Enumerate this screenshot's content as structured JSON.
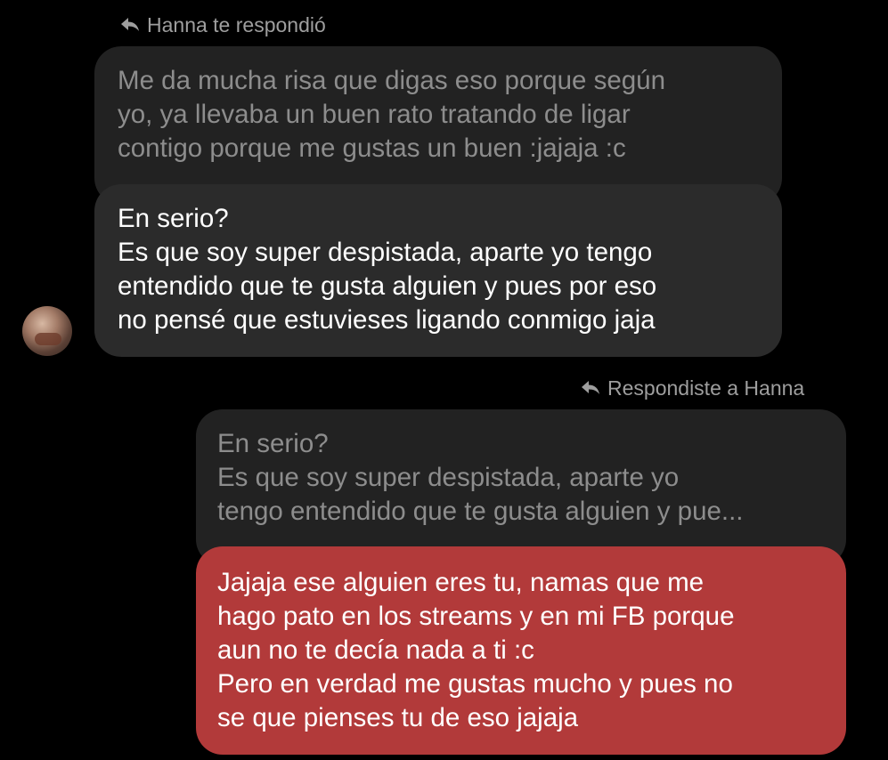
{
  "thread": {
    "first_reply_label": "Hanna te respondió",
    "first_quoted_text": "Me da mucha risa que digas eso porque según\nyo, ya llevaba un buen rato tratando de ligar\ncontigo porque me gustas un buen :jajaja :c",
    "incoming_message": "En serio?\nEs que soy super despistada, aparte yo tengo\nentendido que te gusta alguien y pues por eso\nno pensé que estuvieses ligando conmigo jaja",
    "second_reply_label": "Respondiste a Hanna",
    "second_quoted_text": "En serio?\nEs que soy super despistada, aparte yo\ntengo entendido que te gusta alguien y pue...",
    "outgoing_message": "Jajaja ese alguien eres tu, namas que me\nhago pato en los streams y en mi FB porque\naun no te decía nada a ti :c\nPero en verdad me gustas mucho y pues no\nse que pienses tu de eso jajaja"
  },
  "icons": {
    "reply": "reply-arrow-icon",
    "avatar": "contact-avatar"
  },
  "colors": {
    "background": "#000000",
    "incoming_bubble": "#2b2b2b",
    "quoted_bubble": "#222222",
    "outgoing_bubble": "#b23a3a",
    "meta_text": "#9e9e9e",
    "quoted_text": "#8d8d8d",
    "message_text": "#ffffff"
  }
}
